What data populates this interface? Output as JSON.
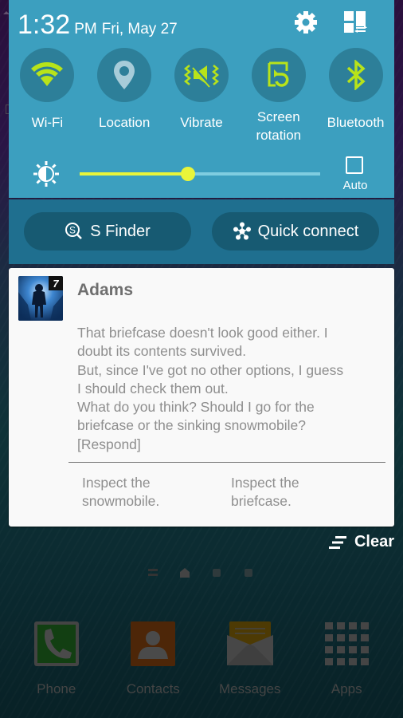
{
  "header": {
    "time": "1:32",
    "ampm": "PM",
    "date": "Fri, May 27",
    "settings_icon": "gear-icon",
    "edit_icon": "grid-edit-icon"
  },
  "quick_toggles": [
    {
      "label": "Wi-Fi",
      "icon": "wifi-icon",
      "state": "on"
    },
    {
      "label": "Location",
      "icon": "location-pin-icon",
      "state": "off"
    },
    {
      "label": "Vibrate",
      "icon": "vibrate-icon",
      "state": "on"
    },
    {
      "label_line1": "Screen",
      "label_line2": "rotation",
      "icon": "screen-rotation-icon",
      "state": "on"
    },
    {
      "label": "Bluetooth",
      "icon": "bluetooth-icon",
      "state": "on"
    }
  ],
  "brightness": {
    "level_percent": 45,
    "auto_label": "Auto",
    "auto_checked": false
  },
  "shortcuts": {
    "s_finder": "S Finder",
    "quick_connect": "Quick connect"
  },
  "notification": {
    "title": "Adams",
    "body_lines": [
      "That briefcase doesn't look good either. I",
      "doubt its contents survived.",
      "But, since I've got no other options, I guess",
      "I should check them out.",
      "What do you think? Should I go for the",
      "briefcase or the sinking snowmobile?",
      "[Respond]"
    ],
    "actions": [
      {
        "line1": "Inspect the",
        "line2": "snowmobile."
      },
      {
        "line1": "Inspect the",
        "line2": "briefcase."
      }
    ],
    "app_badge": "7"
  },
  "clear_label": "Clear",
  "dock": [
    {
      "label": "Phone",
      "icon": "phone-icon"
    },
    {
      "label": "Contacts",
      "icon": "contacts-icon"
    },
    {
      "label": "Messages",
      "icon": "messages-icon"
    },
    {
      "label": "Apps",
      "icon": "apps-grid-icon"
    }
  ],
  "colors": {
    "panel": "#3c9fbf",
    "panel_lower": "#1f6f8f",
    "accent_on": "#b8e31a",
    "slider": "#e9f53a"
  }
}
